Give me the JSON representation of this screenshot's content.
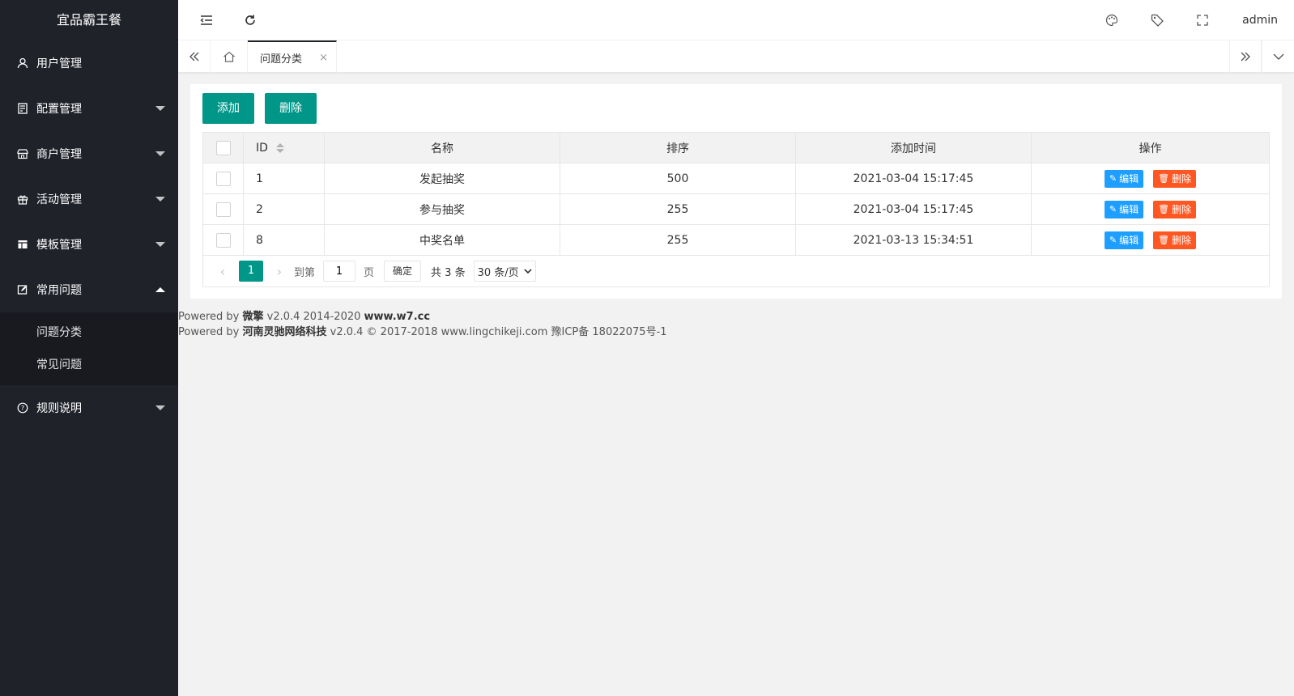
{
  "app": {
    "title": "宜品霸王餐"
  },
  "sidebar": {
    "items": [
      {
        "label": "用户管理",
        "icon": "user-icon",
        "expanded": false,
        "caret": "none"
      },
      {
        "label": "配置管理",
        "icon": "config-icon",
        "expanded": false,
        "caret": "down"
      },
      {
        "label": "商户管理",
        "icon": "store-icon",
        "expanded": false,
        "caret": "down"
      },
      {
        "label": "活动管理",
        "icon": "gift-icon",
        "expanded": false,
        "caret": "down"
      },
      {
        "label": "模板管理",
        "icon": "template-icon",
        "expanded": false,
        "caret": "down"
      },
      {
        "label": "常用问题",
        "icon": "help-edit-icon",
        "expanded": true,
        "caret": "up"
      },
      {
        "label": "规则说明",
        "icon": "question-icon",
        "expanded": false,
        "caret": "down"
      }
    ],
    "submenu": [
      "问题分类",
      "常见问题"
    ]
  },
  "header": {
    "user": "admin"
  },
  "tabs": {
    "active_label": "问题分类",
    "close_glyph": "×"
  },
  "toolbar": {
    "add_label": "添加",
    "delete_label": "删除"
  },
  "table": {
    "columns": [
      "ID",
      "名称",
      "排序",
      "添加时间",
      "操作"
    ],
    "rows": [
      {
        "id": "1",
        "name": "发起抽奖",
        "sort": "500",
        "time": "2021-03-04 15:17:45"
      },
      {
        "id": "2",
        "name": "参与抽奖",
        "sort": "255",
        "time": "2021-03-04 15:17:45"
      },
      {
        "id": "8",
        "name": "中奖名单",
        "sort": "255",
        "time": "2021-03-13 15:34:51"
      }
    ],
    "edit_label": "编辑",
    "delete_label": "删除"
  },
  "pager": {
    "current": "1",
    "goto_label": "到第",
    "goto_value": "1",
    "page_label": "页",
    "confirm_label": "确定",
    "total_label": "共 3 条",
    "per_page": "30 条/页"
  },
  "footer": {
    "line1_prefix": "Powered by ",
    "line1_brand": "微擎",
    "line1_mid": " v2.0.4 2014-2020 ",
    "line1_site": "www.w7.cc",
    "line2_prefix": "Powered by ",
    "line2_brand": "河南灵驰网络科技",
    "line2_rest": " v2.0.4 © 2017-2018 www.lingchikeji.com 豫ICP备 18022075号-1"
  },
  "colors": {
    "sidebar_bg": "#20222a",
    "primary": "#009688",
    "edit": "#1e9fff",
    "danger": "#ff5722"
  }
}
